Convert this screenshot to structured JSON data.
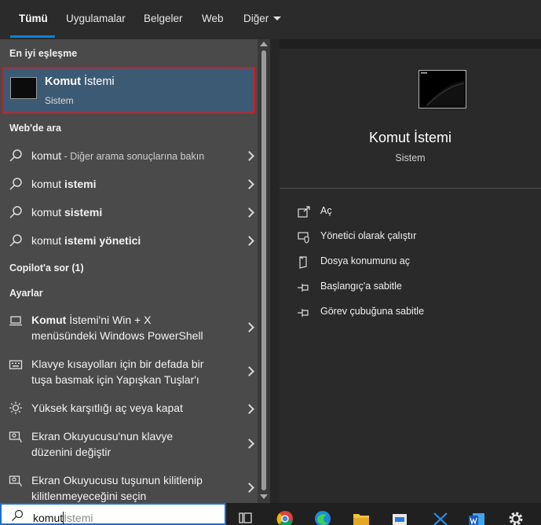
{
  "tabs": [
    {
      "label": "Tümü",
      "active": true
    },
    {
      "label": "Uygulamalar"
    },
    {
      "label": "Belgeler"
    },
    {
      "label": "Web"
    },
    {
      "label": "Diğer"
    }
  ],
  "sections": {
    "best_match": "En iyi eşleşme",
    "web": "Web'de ara",
    "copilot": "Copilot'a sor (1)",
    "settings": "Ayarlar"
  },
  "best_match": {
    "title_bold": "Komut",
    "title_rest": " İstemi",
    "subtitle": "Sistem"
  },
  "web_results": [
    {
      "bold": "komut",
      "rest": "",
      "dim": " - Diğer arama sonuçlarına bakın"
    },
    {
      "bold": "komut ",
      "rest": "istemi",
      "dim": ""
    },
    {
      "bold": "komut ",
      "rest": "sistemi",
      "dim": ""
    },
    {
      "bold": "komut ",
      "rest": "istemi yönetici",
      "dim": ""
    }
  ],
  "settings_results": [
    {
      "bold": "Komut",
      "line1": " İstemi'ni Win + X",
      "line2": "menüsündeki Windows PowerShell",
      "icon": "laptop-icon"
    },
    {
      "bold": "",
      "line1": "Klavye kısayolları için bir defada bir",
      "line2": "tuşa basmak için Yapışkan Tuşlar'ı",
      "icon": "keyboard-icon"
    },
    {
      "bold": "",
      "line1": "Yüksek karşıtlığı aç veya kapat",
      "line2": "",
      "icon": "sun-icon"
    },
    {
      "bold": "",
      "line1": "Ekran Okuyucusu'nun klavye",
      "line2": "düzenini değiştir",
      "icon": "narrator-icon"
    },
    {
      "bold": "",
      "line1": "Ekran Okuyucusu tuşunun kilitlenip",
      "line2": "kilitlenmeyeceğini seçin",
      "icon": "narrator-icon"
    }
  ],
  "preview": {
    "title": "Komut İstemi",
    "subtitle": "Sistem"
  },
  "actions": [
    {
      "label": "Aç",
      "icon": "open-icon"
    },
    {
      "label": "Yönetici olarak çalıştır",
      "icon": "shield-icon"
    },
    {
      "label": "Dosya konumunu aç",
      "icon": "folder-icon"
    },
    {
      "label": "Başlangıç'a sabitle",
      "icon": "pin-icon"
    },
    {
      "label": "Görev çubuğuna sabitle",
      "icon": "pin-icon"
    }
  ],
  "search": {
    "typed": "komut",
    "suggestion": "İstemi"
  },
  "taskbar_icons": [
    "task-view-icon",
    "chrome-icon",
    "edge-icon",
    "file-explorer-icon",
    "store-icon",
    "app-icon",
    "word-icon",
    "settings-icon"
  ],
  "colors": {
    "accent": "#0a84d8",
    "selection": "#3d5a74",
    "highlight_border": "#d6191f"
  }
}
